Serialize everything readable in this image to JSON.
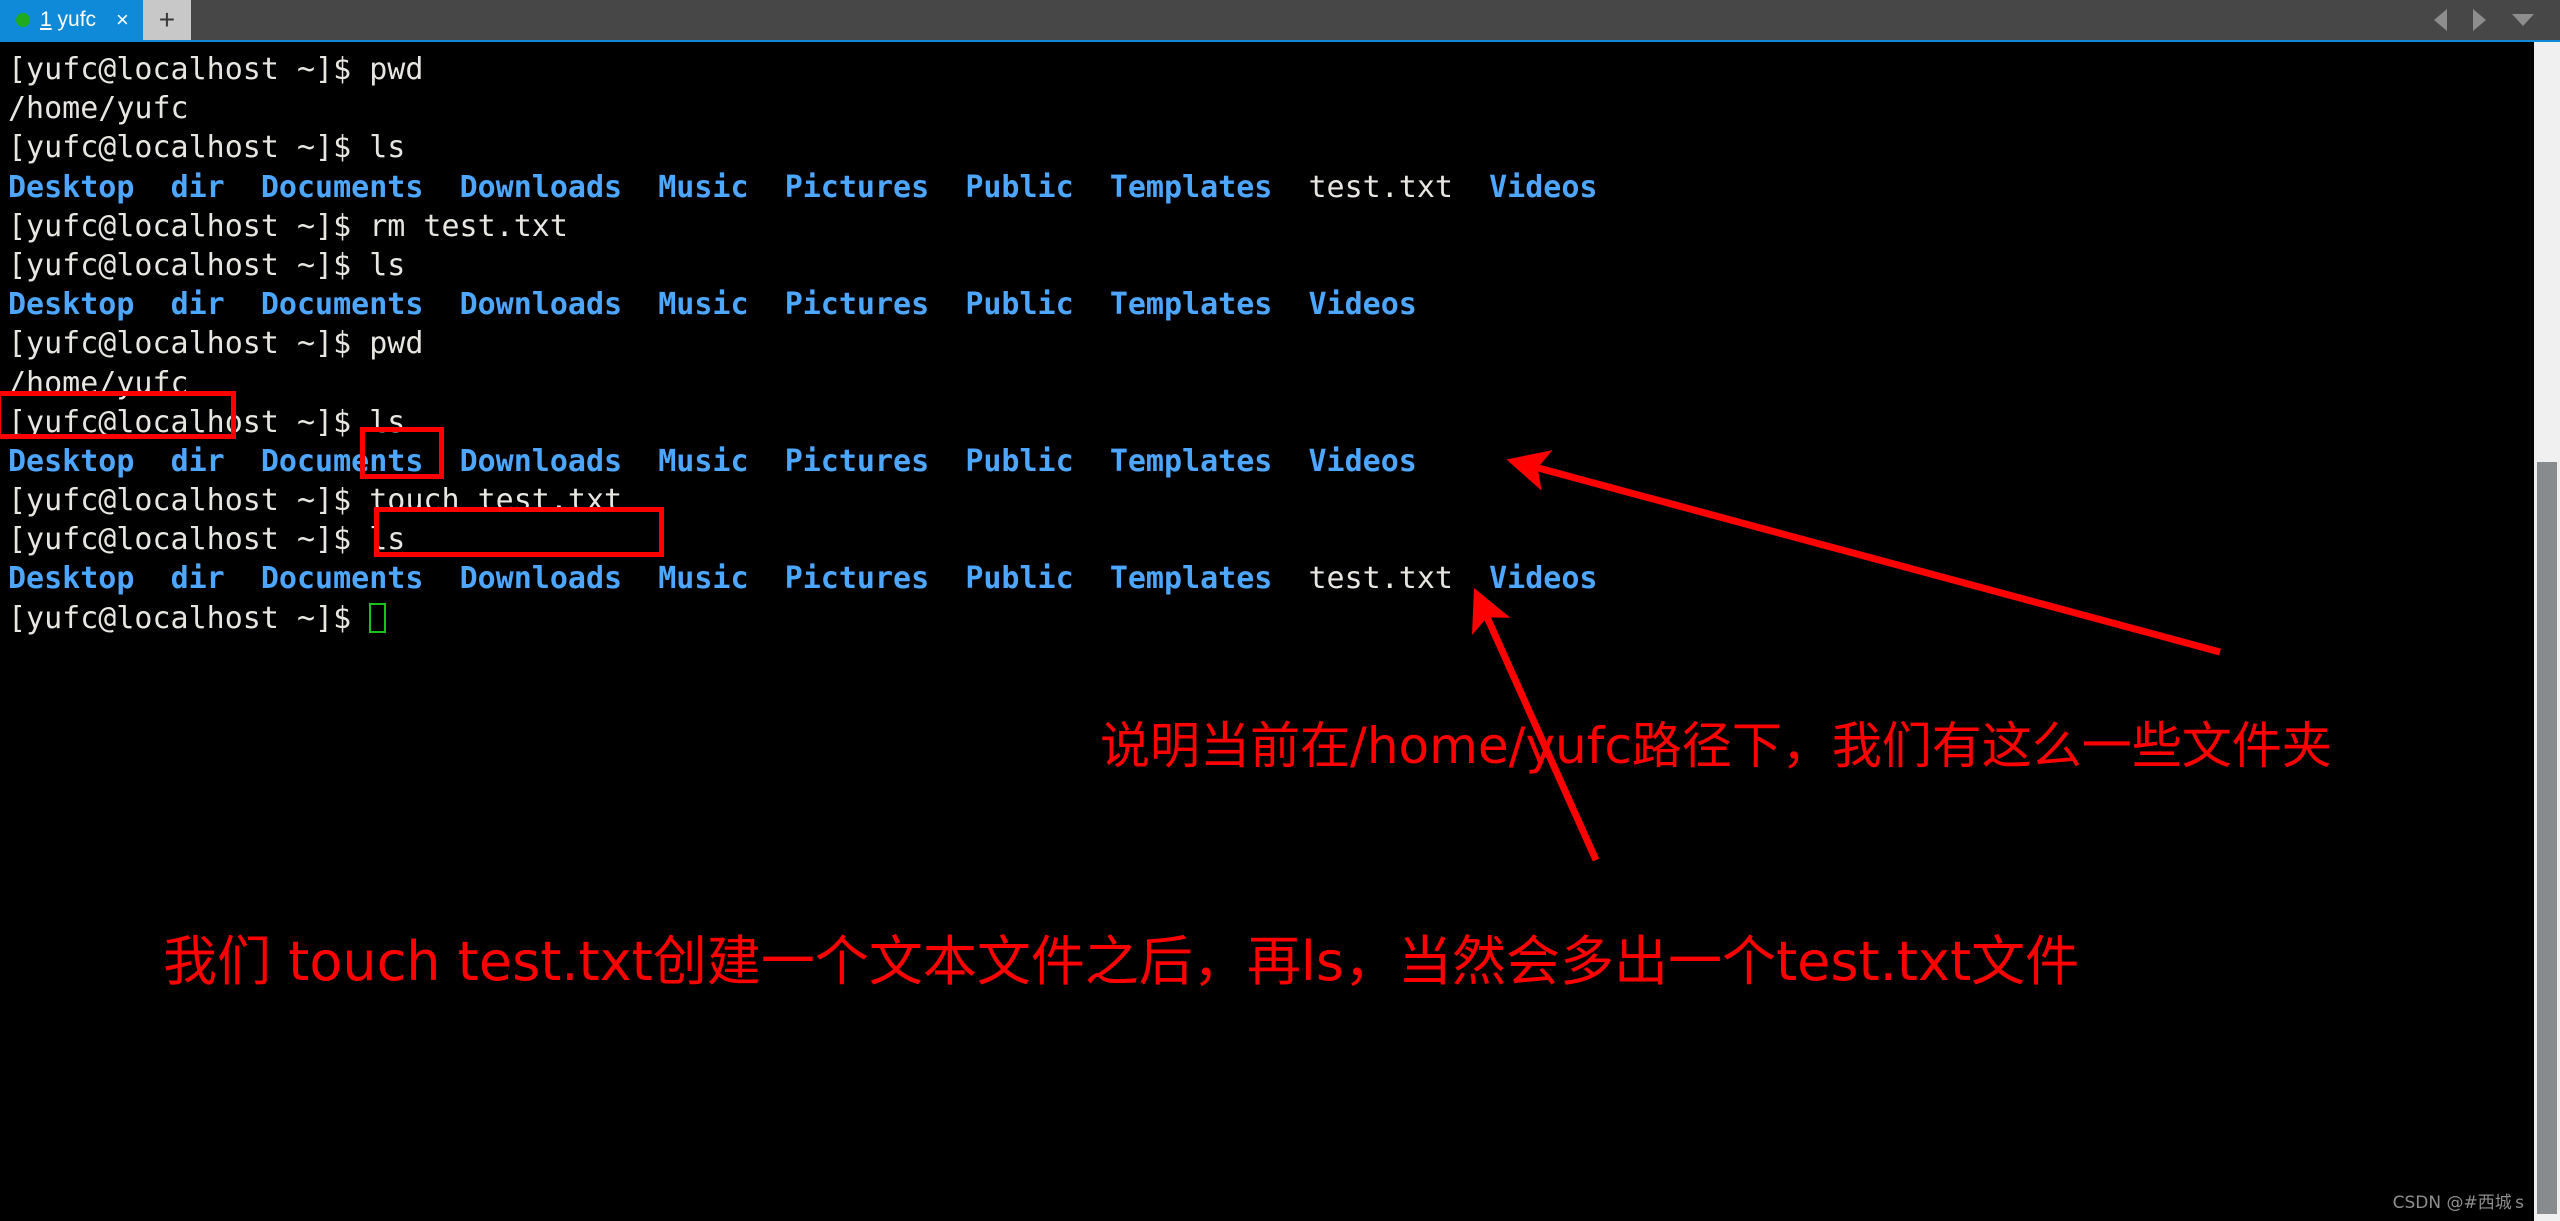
{
  "window": {
    "tab": {
      "number": "1",
      "name": "yufc",
      "label": "1 yufc",
      "status_dot_color": "#1faa1f",
      "close_label": "×"
    },
    "new_tab_label": "+",
    "nav": {
      "prev_label": "◀",
      "next_label": "▶",
      "list_label": "▼"
    },
    "accent_color": "#0e8ad8",
    "bar_color": "#474747"
  },
  "terminal": {
    "prompt": "[yufc@localhost ~]$ ",
    "foreground": "#e8e6e0",
    "dir_color": "#4da6ff",
    "background": "#000000",
    "cursor_color": "#19c319",
    "lines": [
      {
        "type": "prompt",
        "command": "pwd"
      },
      {
        "type": "output",
        "text": "/home/yufc"
      },
      {
        "type": "prompt",
        "command": "ls"
      },
      {
        "type": "ls",
        "entries": [
          "Desktop",
          "dir",
          "Documents",
          "Downloads",
          "Music",
          "Pictures",
          "Public",
          "Templates",
          "test.txt",
          "Videos"
        ],
        "kinds": [
          "dir",
          "dir",
          "dir",
          "dir",
          "dir",
          "dir",
          "dir",
          "dir",
          "file",
          "dir"
        ]
      },
      {
        "type": "prompt",
        "command": "rm test.txt"
      },
      {
        "type": "prompt",
        "command": "ls"
      },
      {
        "type": "ls",
        "entries": [
          "Desktop",
          "dir",
          "Documents",
          "Downloads",
          "Music",
          "Pictures",
          "Public",
          "Templates",
          "Videos"
        ],
        "kinds": [
          "dir",
          "dir",
          "dir",
          "dir",
          "dir",
          "dir",
          "dir",
          "dir",
          "dir"
        ]
      },
      {
        "type": "prompt",
        "command": "pwd"
      },
      {
        "type": "output",
        "text": "/home/yufc"
      },
      {
        "type": "prompt",
        "command": "ls"
      },
      {
        "type": "ls",
        "entries": [
          "Desktop",
          "dir",
          "Documents",
          "Downloads",
          "Music",
          "Pictures",
          "Public",
          "Templates",
          "Videos"
        ],
        "kinds": [
          "dir",
          "dir",
          "dir",
          "dir",
          "dir",
          "dir",
          "dir",
          "dir",
          "dir"
        ]
      },
      {
        "type": "prompt",
        "command": "touch test.txt"
      },
      {
        "type": "prompt",
        "command": "ls"
      },
      {
        "type": "ls",
        "entries": [
          "Desktop",
          "dir",
          "Documents",
          "Downloads",
          "Music",
          "Pictures",
          "Public",
          "Templates",
          "test.txt",
          "Videos"
        ],
        "kinds": [
          "dir",
          "dir",
          "dir",
          "dir",
          "dir",
          "dir",
          "dir",
          "dir",
          "file",
          "dir"
        ]
      },
      {
        "type": "prompt",
        "command": "",
        "cursor": true
      }
    ],
    "raw_lines": [
      "[yufc@localhost ~]$ pwd",
      "/home/yufc",
      "[yufc@localhost ~]$ ls",
      "Desktop  dir  Documents  Downloads  Music  Pictures  Public  Templates  test.txt  Videos",
      "[yufc@localhost ~]$ rm test.txt",
      "[yufc@localhost ~]$ ls",
      "Desktop  dir  Documents  Downloads  Music  Pictures  Public  Templates  Videos",
      "[yufc@localhost ~]$ pwd",
      "/home/yufc",
      "[yufc@localhost ~]$ ls",
      "Desktop  dir  Documents  Downloads  Music  Pictures  Public  Templates  Videos",
      "[yufc@localhost ~]$ touch test.txt",
      "[yufc@localhost ~]$ ls",
      "Desktop  dir  Documents  Downloads  Music  Pictures  Public  Templates  test.txt  Videos",
      "[yufc@localhost ~]$ "
    ]
  },
  "annotations": {
    "color": "#ff0000",
    "highlight_boxes": [
      {
        "name": "pwd-output-box",
        "target": "/home/yufc"
      },
      {
        "name": "ls-command-box",
        "target": "ls"
      },
      {
        "name": "touch-command-box",
        "target": "touch test.txt"
      }
    ],
    "notes": [
      {
        "id": "note-path",
        "text": "说明当前在/home/yufc路径下，我们有这么一些文件夹"
      },
      {
        "id": "note-touch",
        "text": "我们 touch test.txt创建一个文本文件之后，再ls，当然会多出一个test.txt文件"
      }
    ],
    "arrows": [
      {
        "name": "arrow-to-videos",
        "points_to": "Videos"
      },
      {
        "name": "arrow-to-testtxt",
        "points_to": "test.txt"
      }
    ]
  },
  "scrollbar": {
    "orientation": "vertical",
    "thumb_color": "#888b8d",
    "track_color": "#f0f0f0"
  },
  "watermark": {
    "text": "CSDN @#西城 s"
  }
}
